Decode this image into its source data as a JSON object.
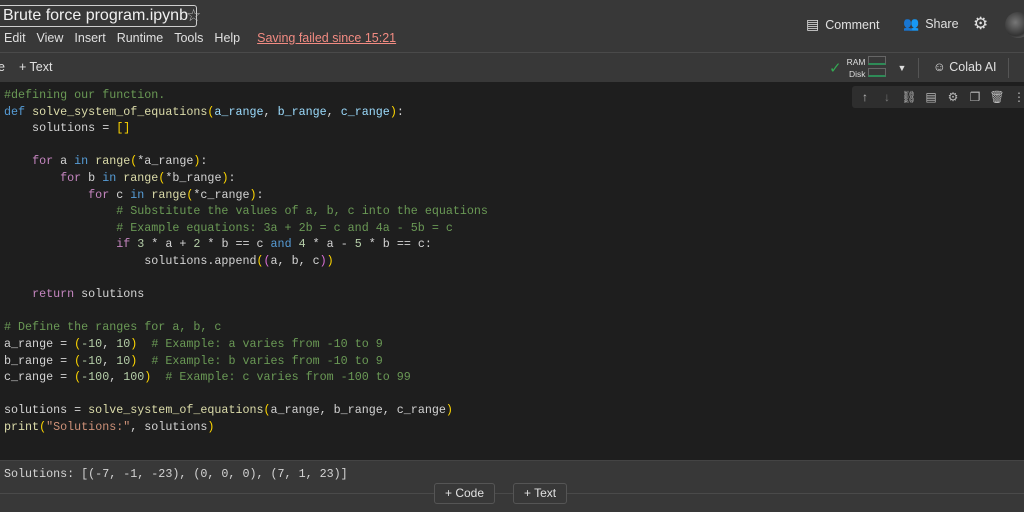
{
  "header": {
    "title": "Brute force program.ipynb",
    "menu": [
      "Edit",
      "View",
      "Insert",
      "Runtime",
      "Tools",
      "Help"
    ],
    "saving_status": "Saving failed since 15:21",
    "comment": "Comment",
    "share": "Share"
  },
  "toolbar": {
    "code_partial": "e",
    "add_text": "+ Text",
    "ram": "RAM",
    "disk": "Disk",
    "colab_ai": "Colab AI"
  },
  "code_lines": [
    [
      [
        "c",
        "#defining our function."
      ]
    ],
    [
      [
        "kb",
        "def"
      ],
      [
        "o",
        " "
      ],
      [
        "f",
        "solve_system_of_equations"
      ],
      [
        "p",
        "("
      ],
      [
        "v",
        "a_range"
      ],
      [
        "o",
        ", "
      ],
      [
        "v",
        "b_range"
      ],
      [
        "o",
        ", "
      ],
      [
        "v",
        "c_range"
      ],
      [
        "p",
        ")"
      ],
      [
        "o",
        ":"
      ]
    ],
    [
      [
        "o",
        "    solutions = "
      ],
      [
        "p",
        "[]"
      ]
    ],
    [
      [
        "o",
        ""
      ]
    ],
    [
      [
        "o",
        "    "
      ],
      [
        "kp",
        "for"
      ],
      [
        "o",
        " a "
      ],
      [
        "kb",
        "in"
      ],
      [
        "o",
        " "
      ],
      [
        "f",
        "range"
      ],
      [
        "p",
        "("
      ],
      [
        "o",
        "*a_range"
      ],
      [
        "p",
        ")"
      ],
      [
        "o",
        ":"
      ]
    ],
    [
      [
        "o",
        "        "
      ],
      [
        "kp",
        "for"
      ],
      [
        "o",
        " b "
      ],
      [
        "kb",
        "in"
      ],
      [
        "o",
        " "
      ],
      [
        "f",
        "range"
      ],
      [
        "p",
        "("
      ],
      [
        "o",
        "*b_range"
      ],
      [
        "p",
        ")"
      ],
      [
        "o",
        ":"
      ]
    ],
    [
      [
        "o",
        "            "
      ],
      [
        "kp",
        "for"
      ],
      [
        "o",
        " c "
      ],
      [
        "kb",
        "in"
      ],
      [
        "o",
        " "
      ],
      [
        "f",
        "range"
      ],
      [
        "p",
        "("
      ],
      [
        "o",
        "*c_range"
      ],
      [
        "p",
        ")"
      ],
      [
        "o",
        ":"
      ]
    ],
    [
      [
        "o",
        "                "
      ],
      [
        "c",
        "# Substitute the values of a, b, c into the equations"
      ]
    ],
    [
      [
        "o",
        "                "
      ],
      [
        "c",
        "# Example equations: 3a + 2b = c and 4a - 5b = c"
      ]
    ],
    [
      [
        "o",
        "                "
      ],
      [
        "kp",
        "if"
      ],
      [
        "o",
        " "
      ],
      [
        "n",
        "3"
      ],
      [
        "o",
        " * a + "
      ],
      [
        "n",
        "2"
      ],
      [
        "o",
        " * b == c "
      ],
      [
        "kb",
        "and"
      ],
      [
        "o",
        " "
      ],
      [
        "n",
        "4"
      ],
      [
        "o",
        " * a - "
      ],
      [
        "n",
        "5"
      ],
      [
        "o",
        " * b == c:"
      ]
    ],
    [
      [
        "o",
        "                    solutions.append"
      ],
      [
        "p",
        "("
      ],
      [
        "pp",
        "("
      ],
      [
        "o",
        "a, b, c"
      ],
      [
        "pp",
        ")"
      ],
      [
        "p",
        ")"
      ]
    ],
    [
      [
        "o",
        ""
      ]
    ],
    [
      [
        "o",
        "    "
      ],
      [
        "kp",
        "return"
      ],
      [
        "o",
        " solutions"
      ]
    ],
    [
      [
        "o",
        ""
      ]
    ],
    [
      [
        "c",
        "# Define the ranges for a, b, c"
      ]
    ],
    [
      [
        "o",
        "a_range = "
      ],
      [
        "p",
        "("
      ],
      [
        "n",
        "-10"
      ],
      [
        "o",
        ", "
      ],
      [
        "n",
        "10"
      ],
      [
        "p",
        ")"
      ],
      [
        "o",
        "  "
      ],
      [
        "c",
        "# Example: a varies from -10 to 9"
      ]
    ],
    [
      [
        "o",
        "b_range = "
      ],
      [
        "p",
        "("
      ],
      [
        "n",
        "-10"
      ],
      [
        "o",
        ", "
      ],
      [
        "n",
        "10"
      ],
      [
        "p",
        ")"
      ],
      [
        "o",
        "  "
      ],
      [
        "c",
        "# Example: b varies from -10 to 9"
      ]
    ],
    [
      [
        "o",
        "c_range = "
      ],
      [
        "p",
        "("
      ],
      [
        "n",
        "-100"
      ],
      [
        "o",
        ", "
      ],
      [
        "n",
        "100"
      ],
      [
        "p",
        ")"
      ],
      [
        "o",
        "  "
      ],
      [
        "c",
        "# Example: c varies from -100 to 99"
      ]
    ],
    [
      [
        "o",
        ""
      ]
    ],
    [
      [
        "o",
        "solutions = "
      ],
      [
        "f",
        "solve_system_of_equations"
      ],
      [
        "p",
        "("
      ],
      [
        "o",
        "a_range, b_range, c_range"
      ],
      [
        "p",
        ")"
      ]
    ],
    [
      [
        "f",
        "print"
      ],
      [
        "p",
        "("
      ],
      [
        "s",
        "\"Solutions:\""
      ],
      [
        "o",
        ", solutions"
      ],
      [
        "p",
        ")"
      ]
    ]
  ],
  "output": "Solutions: [(-7, -1, -23), (0, 0, 0), (7, 1, 23)]",
  "bottom": {
    "add_code": "+  Code",
    "add_text": "+  Text"
  }
}
